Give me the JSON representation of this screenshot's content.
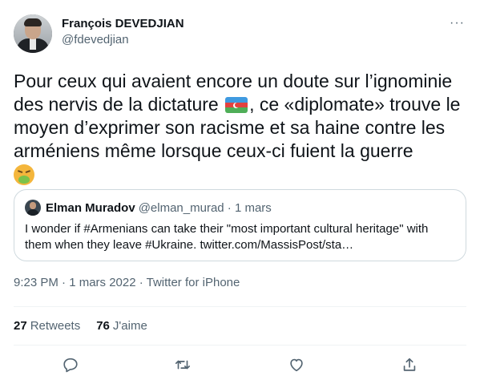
{
  "tweet": {
    "author": {
      "display_name": "François DEVEDJIAN",
      "handle": "@fdevedjian"
    },
    "text_part1": "Pour ceux qui avaient encore un doute sur l’ignominie des nervis de la dictature ",
    "text_part2": ", ce «diplomate» trouve le moyen d’exprimer son racisme et sa haine contre les arméniens même lorsque ceux-ci fuient la guerre",
    "more_label": "···",
    "quote": {
      "display_name": "Elman Muradov",
      "handle_date": "@elman_murad · 1 mars",
      "text": "I wonder if #Armenians can take their \"most important cultural heritage\" with them when they leave #Ukraine. twitter.com/MassisPost/sta…"
    },
    "meta": "9:23 PM · 1 mars 2022 · Twitter for iPhone",
    "stats": {
      "retweets_count": "27",
      "retweets_label": "Retweets",
      "likes_count": "76",
      "likes_label": "J'aime"
    }
  },
  "icons": {
    "flag": "azerbaijan-flag-icon",
    "emoji": "nauseated-face-icon",
    "actions": [
      "reply-icon",
      "retweet-icon",
      "like-icon",
      "share-icon"
    ]
  },
  "colors": {
    "text": "#0f1419",
    "secondary": "#536471",
    "border": "#cfd9de"
  }
}
